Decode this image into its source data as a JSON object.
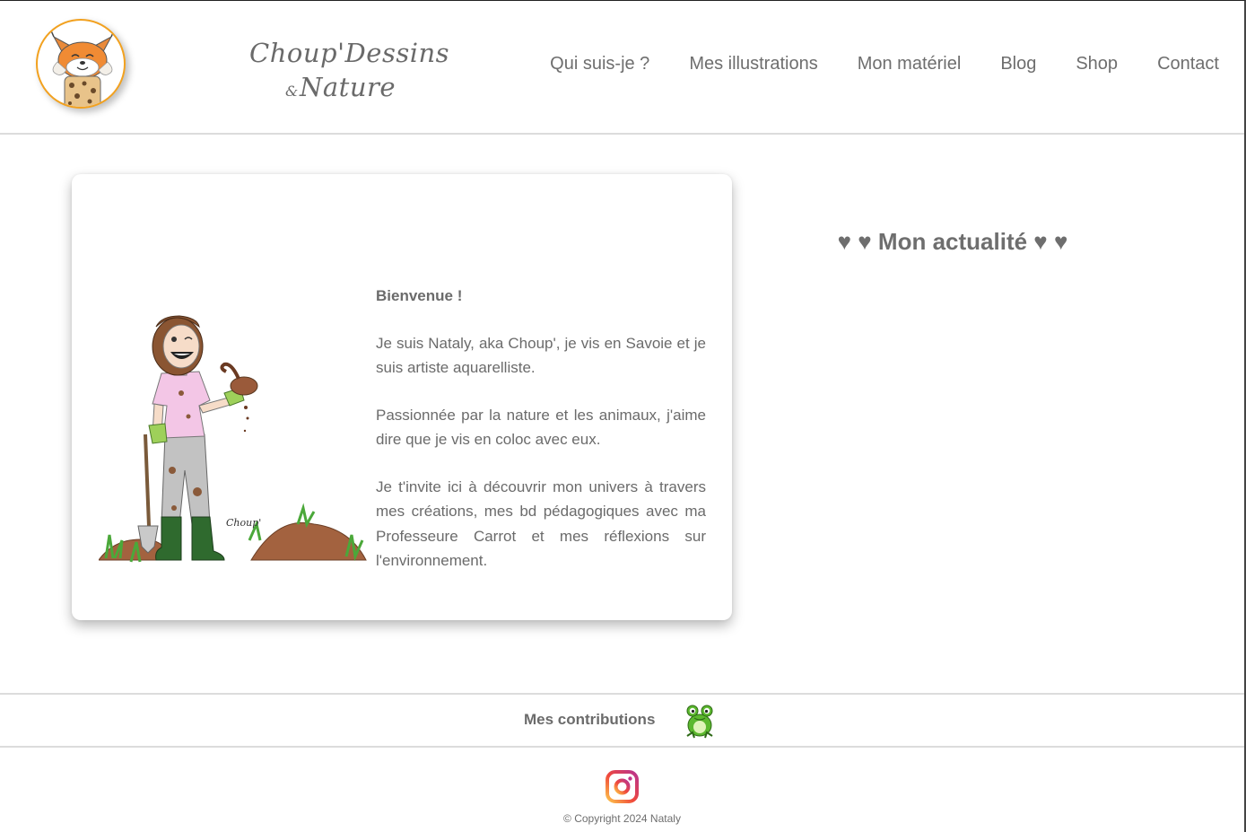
{
  "brand": {
    "line1": "Choup'Dessins",
    "amp": "&",
    "line2": "Nature"
  },
  "nav": {
    "items": [
      {
        "label": "Qui suis-je ?"
      },
      {
        "label": "Mes illustrations"
      },
      {
        "label": "Mon matériel"
      },
      {
        "label": "Blog"
      },
      {
        "label": "Shop"
      },
      {
        "label": "Contact"
      }
    ]
  },
  "intro": {
    "greeting": "Bienvenue !",
    "paragraphs": [
      "Je suis Nataly, aka Choup', je vis en Savoie et je suis artiste aquarelliste.",
      "Passionnée par la nature et les animaux, j'aime dire que je vis en coloc avec eux.",
      "Je t'invite ici à découvrir mon univers à travers mes créations, mes bd pédagogiques avec ma Professeure Carrot et mes réflexions sur l'environnement."
    ],
    "illustration_signature": "Choup'"
  },
  "news": {
    "title": "♥ ♥ Mon actualité ♥ ♥"
  },
  "contributions": {
    "label": "Mes contributions"
  },
  "footer": {
    "copyright": "© Copyright 2024 Nataly"
  },
  "colors": {
    "text": "#6e6e6e",
    "avatar_border": "#f2a11f",
    "divider": "#dcdcdc",
    "frog_green": "#5cb82e",
    "shirt_pink": "#f3c6e6",
    "dirt_brown": "#9a5a3a"
  },
  "icons": {
    "avatar": "lynx-avatar-icon",
    "contrib": "frog-icon",
    "social": "instagram-icon"
  }
}
